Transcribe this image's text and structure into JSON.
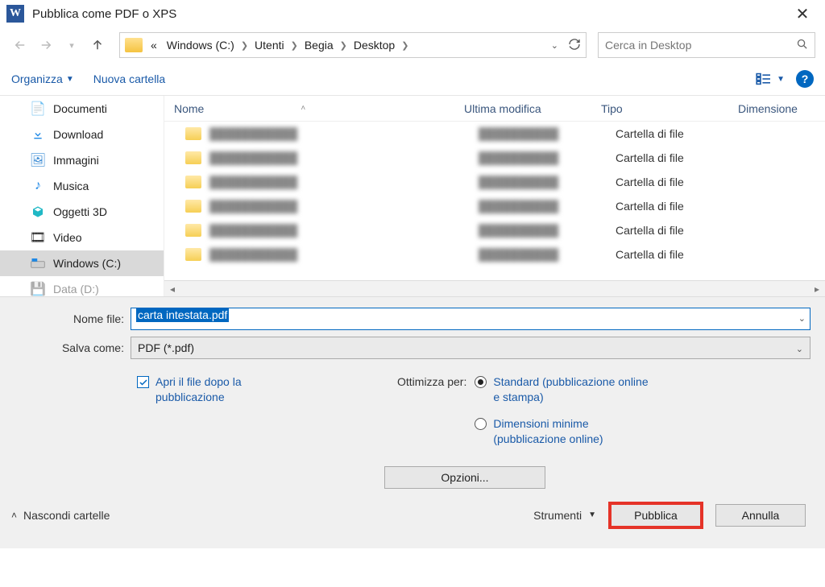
{
  "window": {
    "title": "Pubblica come PDF o XPS"
  },
  "breadcrumb": {
    "prefix": "«",
    "parts": [
      "Windows (C:)",
      "Utenti",
      "Begia",
      "Desktop"
    ]
  },
  "search": {
    "placeholder": "Cerca in Desktop"
  },
  "toolbar": {
    "organize": "Organizza",
    "new_folder": "Nuova cartella"
  },
  "sidebar": {
    "items": [
      {
        "label": "Documenti",
        "icon": "doc"
      },
      {
        "label": "Download",
        "icon": "download"
      },
      {
        "label": "Immagini",
        "icon": "image"
      },
      {
        "label": "Musica",
        "icon": "music"
      },
      {
        "label": "Oggetti 3D",
        "icon": "cube"
      },
      {
        "label": "Video",
        "icon": "video"
      },
      {
        "label": "Windows (C:)",
        "icon": "drive",
        "selected": true
      },
      {
        "label": "Data (D:)",
        "icon": "drive"
      }
    ]
  },
  "columns": {
    "name": "Nome",
    "modified": "Ultima modifica",
    "type": "Tipo",
    "size": "Dimensione"
  },
  "file_type_label": "Cartella di file",
  "row_count": 6,
  "form": {
    "filename_label": "Nome file:",
    "filename_value": "carta intestata.pdf",
    "saveas_label": "Salva come:",
    "saveas_value": "PDF (*.pdf)"
  },
  "options": {
    "open_after": "Apri il file dopo la pubblicazione",
    "optimize_label": "Ottimizza per:",
    "standard": "Standard (pubblicazione online e stampa)",
    "minimal": "Dimensioni minime (pubblicazione online)",
    "options_btn": "Opzioni..."
  },
  "bottom": {
    "hide_folders": "Nascondi cartelle",
    "tools": "Strumenti",
    "publish": "Pubblica",
    "cancel": "Annulla"
  }
}
